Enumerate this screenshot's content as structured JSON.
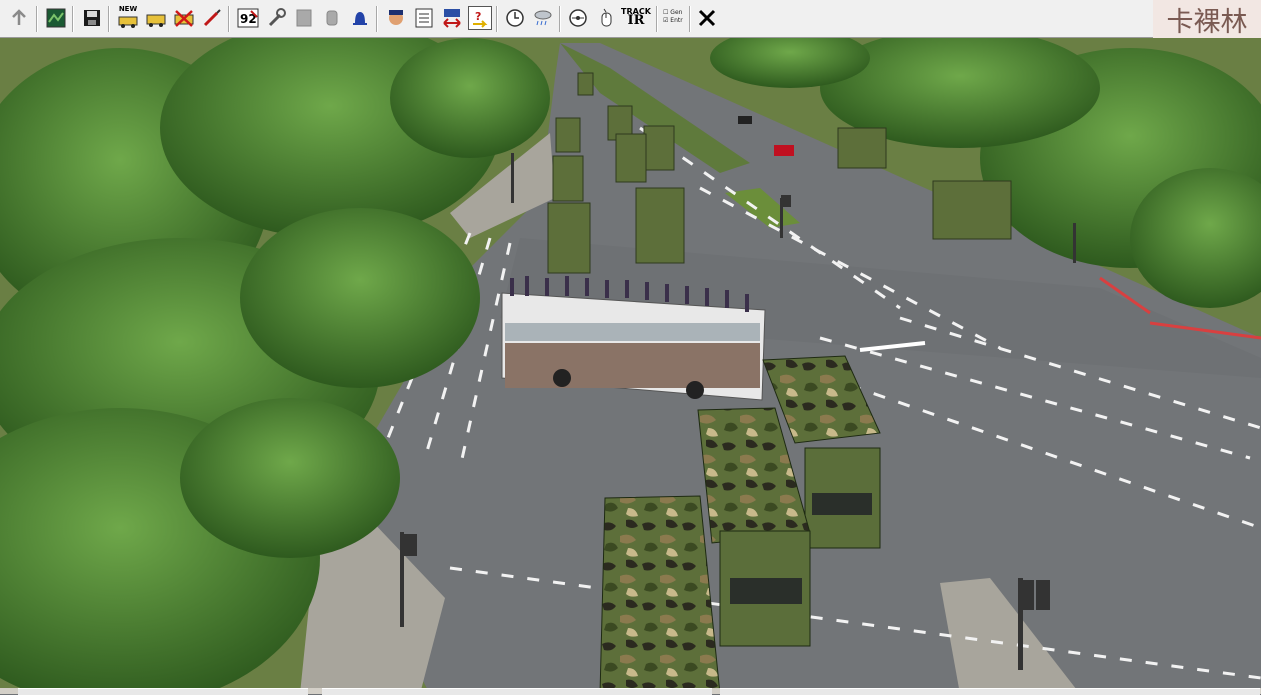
{
  "toolbar": {
    "new_label": "NEW",
    "track_label_top": "TRACK",
    "track_label_bottom": "IR",
    "check_labels": [
      "Gen",
      "Entr"
    ],
    "icons": [
      "up-arrow-icon",
      "map-icon",
      "save-icon",
      "new-vehicle-icon",
      "vehicle-icon",
      "delete-vehicle-icon",
      "edit-tool-icon",
      "number-icon",
      "wrench-icon",
      "blank-icon",
      "cylinder-icon",
      "bell-icon",
      "driver-icon",
      "list-icon",
      "transfer-icon",
      "help-icon",
      "clock-icon",
      "weather-icon",
      "compass-icon",
      "mouse-icon",
      "track-ir-icon",
      "checkbox-icon",
      "close-icon"
    ]
  },
  "watermark": {
    "text": "卡裸林"
  },
  "scene": {
    "description_colors": {
      "road": "#6f7276",
      "grass": "#5f7a3c",
      "tree": "#3f7a2a",
      "camo": "#586b3a",
      "bus": "#e8e8e8"
    }
  }
}
